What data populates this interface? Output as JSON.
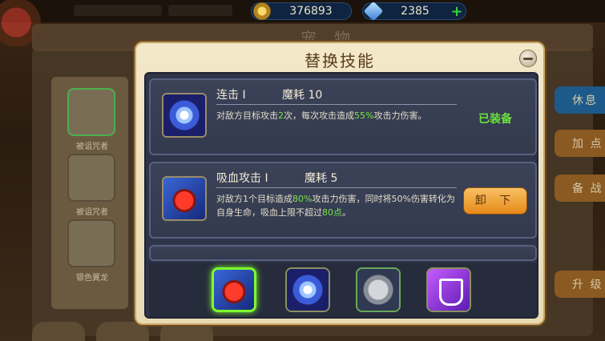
{
  "resources": {
    "gold": "376893",
    "gems": "2385",
    "gold_icon": "coin-icon",
    "gem_icon": "diamond-icon"
  },
  "background": {
    "title": "宠 物",
    "pets": [
      "被诅咒者",
      "被诅咒者",
      "银色翼龙"
    ],
    "side_buttons": [
      "休息",
      "加 点",
      "备 战",
      "升 级"
    ]
  },
  "modal": {
    "title": "替换技能",
    "skills": [
      {
        "name": "连击 I",
        "cost_label": "魔耗",
        "cost": "10",
        "desc_parts": [
          "对敌方目标攻击",
          "2",
          "次，每次攻击造成",
          "55%",
          "攻击力伤害。"
        ],
        "status": "已装备",
        "icon": "energy-orb-icon"
      },
      {
        "name": "吸血攻击 I",
        "cost_label": "魔耗",
        "cost": "5",
        "desc_parts": [
          "对敌方1个目标造成",
          "80%",
          "攻击力伤害，同时将50%伤害转化为自身生命，吸血上限不超过",
          "80点",
          "。"
        ],
        "action": "卸 下",
        "icon": "blood-drain-icon"
      }
    ],
    "slots": [
      "blood-drain-icon",
      "energy-orb-icon",
      "stone-icon",
      "shield-icon"
    ]
  },
  "colors": {
    "highlight": "#79e34a",
    "equipped": "#6be13d",
    "button": "#e58a18"
  }
}
